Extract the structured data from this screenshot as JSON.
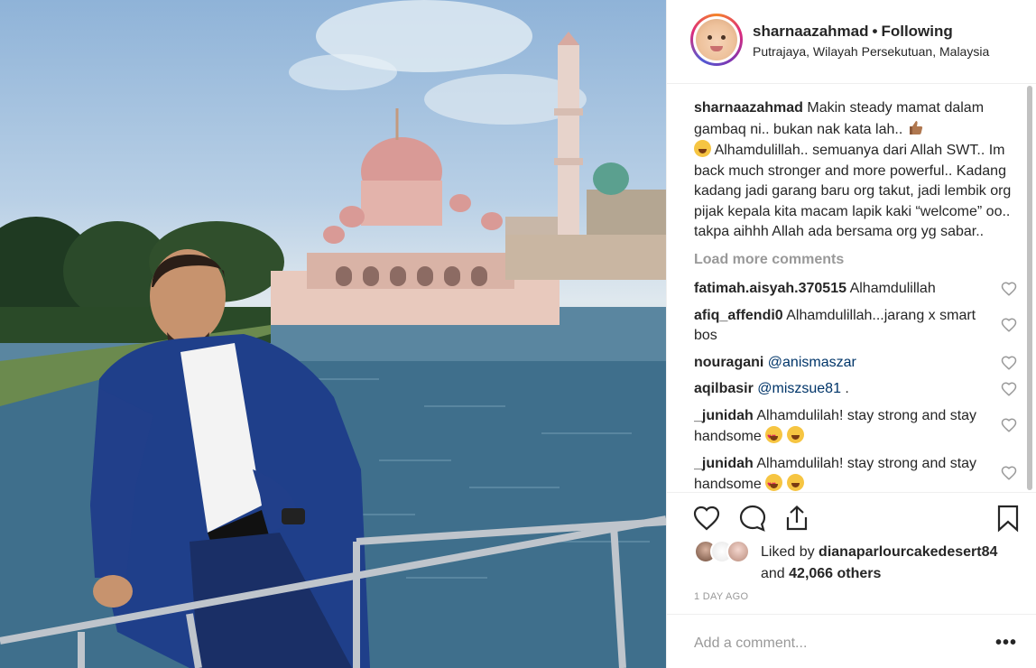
{
  "header": {
    "username": "sharnaazahmad",
    "separator": "•",
    "follow_label": "Following",
    "location": "Putrajaya, Wilayah Persekutuan, Malaysia"
  },
  "caption": {
    "username": "sharnaazahmad",
    "text_part1": "Makin steady mamat dalam gambaq ni.. bukan nak kata lah.. ",
    "text_part2": " Alhamdulillah.. semuanya dari Allah SWT.. Im back much stronger and more powerful.. Kadang kadang jadi garang baru org takut, jadi lembik org pijak kepala kita macam lapik kaki “welcome” oo.. takpa aihhh Allah ada bersama org yg sabar..",
    "emoji1": "thumbs-up-emoji",
    "emoji2": "laughing-emoji"
  },
  "load_more": "Load more comments",
  "comments": [
    {
      "username": "fatimah.aisyah.370515",
      "text": " Alhamdulillah"
    },
    {
      "username": "afiq_affendi0",
      "text": " Alhamdulillah...jarang x smart bos"
    },
    {
      "username": "nouragani",
      "text": "",
      "mention": " @anismaszar"
    },
    {
      "username": "aqilbasir",
      "text": " .",
      "mention": " @miszsue81"
    },
    {
      "username": "_junidah",
      "text": " Alhamdulilah! stay strong and stay handsome "
    },
    {
      "username": "_junidah",
      "text": " Alhamdulilah! stay strong and stay handsome "
    }
  ],
  "likes": {
    "prefix": "Liked by ",
    "user": "dianaparlourcakedesert84",
    "and": "and ",
    "others": "42,066 others"
  },
  "timestamp": "1 DAY AGO",
  "add_comment_placeholder": "Add a comment...",
  "more_label": "•••",
  "icons": {
    "like": "heart-icon",
    "comment": "comment-icon",
    "share": "share-icon",
    "save": "bookmark-icon"
  }
}
